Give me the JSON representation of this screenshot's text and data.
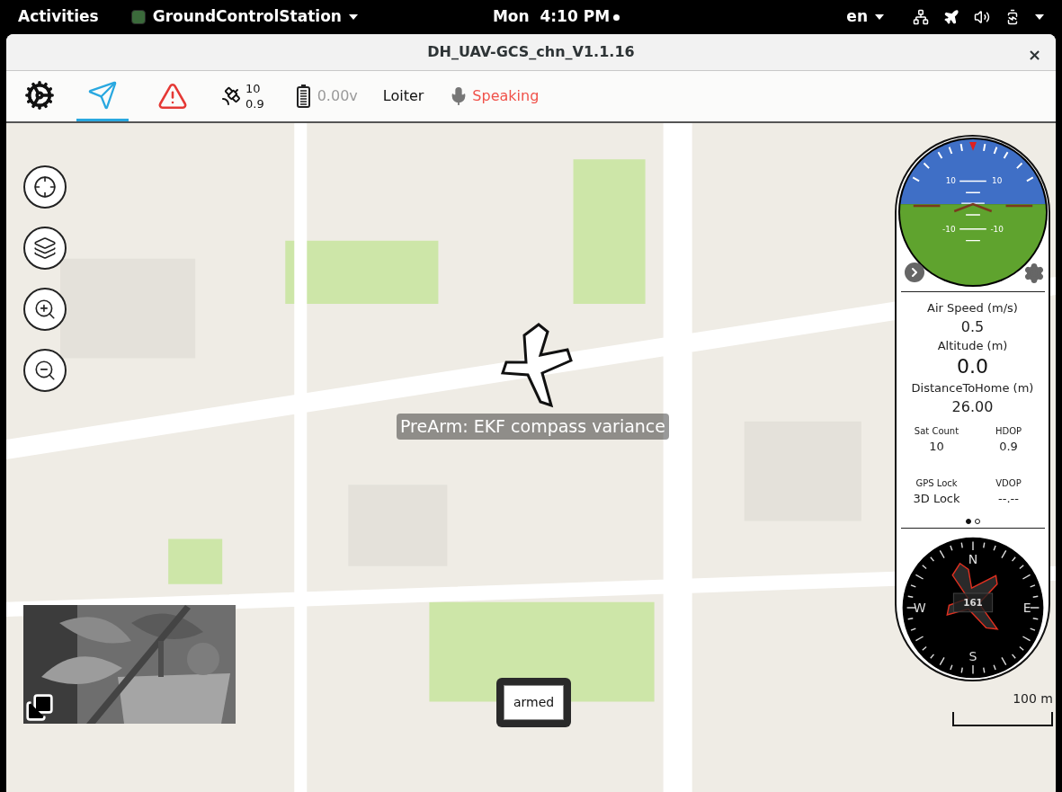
{
  "topbar": {
    "activities": "Activities",
    "app_menu": "GroundControlStation",
    "clock": "Mon  4:10 PM",
    "language": "en"
  },
  "window": {
    "title": "DH_UAV-GCS_chn_V1.1.16",
    "close": "×"
  },
  "toolbar": {
    "tabs": [
      {
        "kind": "settings",
        "selected": false
      },
      {
        "kind": "flight",
        "selected": true
      }
    ],
    "satellites": "10",
    "hdop": "0.9",
    "voltage": "0.00v",
    "mode": "Loiter",
    "speech": "Speaking"
  },
  "map": {
    "message": "PreArm: EKF compass variance",
    "scale": "100 m",
    "status": "armed"
  },
  "attitude": {
    "pitch_labels": [
      "10",
      "10",
      "-10",
      "-10"
    ]
  },
  "telemetry": {
    "primary": [
      {
        "label": "Air Speed (m/s)",
        "value": "0.5",
        "emphasis": false
      },
      {
        "label": "Altitude (m)",
        "value": "0.0",
        "emphasis": true
      },
      {
        "label": "DistanceToHome (m)",
        "value": "26.00",
        "emphasis": false
      }
    ],
    "secondary": [
      {
        "label": "Sat Count",
        "value": "10"
      },
      {
        "label": "HDOP",
        "value": "0.9"
      },
      {
        "label": "GPS Lock",
        "value": "3D Lock"
      },
      {
        "label": "VDOP",
        "value": "--.--"
      }
    ],
    "pages": [
      {
        "selected": true
      },
      {
        "selected": false
      }
    ]
  },
  "compass": {
    "north": "N",
    "east": "E",
    "south": "S",
    "west": "W",
    "heading": "161"
  }
}
